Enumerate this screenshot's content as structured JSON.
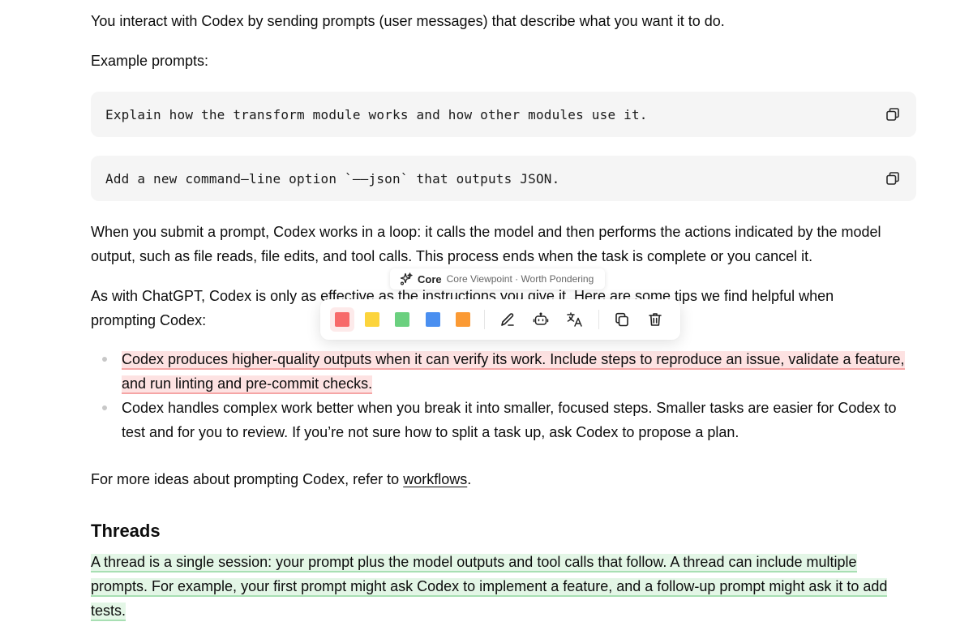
{
  "intro": "You interact with Codex by sending prompts (user messages) that describe what you want it to do.",
  "example_heading": "Example prompts:",
  "code_blocks": [
    {
      "text": "Explain how the transform module works and how other modules use it.",
      "copy_icon": "copy-icon"
    },
    {
      "text": "Add a new command–line option `––json` that outputs JSON.",
      "copy_icon": "copy-icon"
    }
  ],
  "loop_paragraph": "When you submit a prompt, Codex works in a loop: it calls the model and then performs the actions indicated by the model output, such as file reads, file edits, and tool calls. This process ends when the task is complete or you cancel it.",
  "chatgpt_paragraph": "As with ChatGPT, Codex is only as effective as the instructions you give it. Here are some tips we find helpful when prompting Codex:",
  "tips": [
    "Codex produces higher-quality outputs when it can verify its work. Include steps to reproduce an issue, validate a feature, and run linting and pre-commit checks.",
    "Codex handles complex work better when you break it into smaller, focused steps. Smaller tasks are easier for Codex to test and for you to review. If you’re not sure how to split a task up, ask Codex to propose a plan."
  ],
  "more_ideas": {
    "prefix": "For more ideas about prompting Codex, refer to ",
    "link": "workflows",
    "suffix": "."
  },
  "threads_heading": "Threads",
  "threads_paragraph": "A thread is a single session: your prompt plus the model outputs and tool calls that follow. A thread can include multiple prompts. For example, your first prompt might ask Codex to implement a feature, and a follow-up prompt might ask it to add tests.",
  "floating_label": {
    "icon": "sparkle-icon",
    "name": "Core",
    "subtitle": "Core Viewpoint · Worth Pondering"
  },
  "toolbar": {
    "colors": [
      {
        "name": "red",
        "hex": "#f76a6a",
        "active": true
      },
      {
        "name": "yellow",
        "hex": "#fcd43c",
        "active": false
      },
      {
        "name": "green",
        "hex": "#6bd07f",
        "active": false
      },
      {
        "name": "blue",
        "hex": "#4a8ff0",
        "active": false
      },
      {
        "name": "orange",
        "hex": "#fb9a34",
        "active": false
      }
    ],
    "tools": [
      "pen-icon",
      "robot-icon",
      "translate-icon",
      "copy-icon",
      "trash-icon"
    ]
  },
  "highlight_colors": {
    "red_bg": "#fde2e2",
    "green_bg": "#e3f6e6"
  }
}
